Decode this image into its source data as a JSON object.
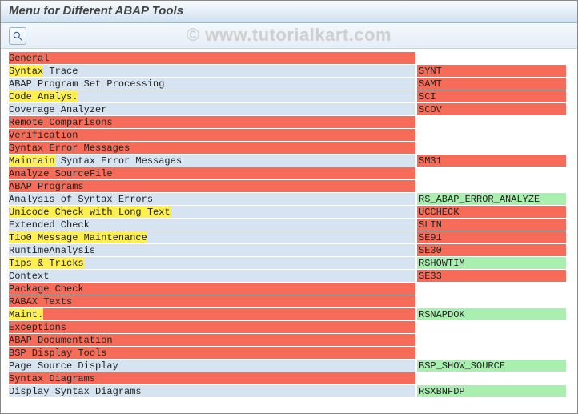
{
  "title": "Menu for Different ABAP Tools",
  "watermark": "© www.tutorialkart.com",
  "rows": [
    {
      "label": "General",
      "label_bg": "red",
      "hl_text": "",
      "hl_bg": "",
      "code": "",
      "code_bg": "none"
    },
    {
      "label": " Trace",
      "label_bg": "blue",
      "hl_text": "Syntax",
      "hl_bg": "yellow",
      "code": "SYNT",
      "code_bg": "red"
    },
    {
      "label": "ABAP Program Set Processing",
      "label_bg": "blue",
      "hl_text": "",
      "hl_bg": "",
      "code": "SAMT",
      "code_bg": "red"
    },
    {
      "label": "",
      "label_bg": "blue",
      "hl_text": "Code Analys.",
      "hl_bg": "yellow",
      "code": "SCI",
      "code_bg": "red"
    },
    {
      "label": "Coverage Analyzer",
      "label_bg": "blue",
      "hl_text": "",
      "hl_bg": "",
      "code": "SCOV",
      "code_bg": "red"
    },
    {
      "label": "Remote Comparisons",
      "label_bg": "red",
      "hl_text": "",
      "hl_bg": "",
      "code": "",
      "code_bg": "none"
    },
    {
      "label": "Verification",
      "label_bg": "red",
      "hl_text": "",
      "hl_bg": "",
      "code": "",
      "code_bg": "none"
    },
    {
      "label": "Syntax Error Messages",
      "label_bg": "red",
      "hl_text": "",
      "hl_bg": "",
      "code": "",
      "code_bg": "none"
    },
    {
      "label": " Syntax Error Messages",
      "label_bg": "blue",
      "hl_text": "Maintain",
      "hl_bg": "yellow",
      "code": "SM31",
      "code_bg": "red"
    },
    {
      "label": "Analyze SourceFile",
      "label_bg": "red",
      "hl_text": "",
      "hl_bg": "",
      "code": "",
      "code_bg": "none"
    },
    {
      "label": "ABAP Programs",
      "label_bg": "red",
      "hl_text": "",
      "hl_bg": "",
      "code": "",
      "code_bg": "none"
    },
    {
      "label": "Analysis of Syntax Errors",
      "label_bg": "blue",
      "hl_text": "",
      "hl_bg": "",
      "code": "RS_ABAP_ERROR_ANALYZE",
      "code_bg": "green"
    },
    {
      "label": "",
      "label_bg": "blue",
      "hl_text": "Unicode Check with Long Text",
      "hl_bg": "yellow",
      "code": "UCCHECK",
      "code_bg": "red"
    },
    {
      "label": "Extended Check",
      "label_bg": "blue",
      "hl_text": "",
      "hl_bg": "",
      "code": "SLIN",
      "code_bg": "red"
    },
    {
      "label": "",
      "label_bg": "blue",
      "hl_text": "T1o0 Message Maintenance",
      "hl_bg": "yellow",
      "code": "SE91",
      "code_bg": "red"
    },
    {
      "label": "RuntimeAnalysis",
      "label_bg": "blue",
      "hl_text": "",
      "hl_bg": "",
      "code": "SE30",
      "code_bg": "red"
    },
    {
      "label": "",
      "label_bg": "blue",
      "hl_text": "Tips & Tricks",
      "hl_bg": "yellow",
      "code": "RSHOWTIM",
      "code_bg": "green"
    },
    {
      "label": "Context",
      "label_bg": "blue",
      "hl_text": "",
      "hl_bg": "",
      "code": "SE33",
      "code_bg": "red"
    },
    {
      "label": "Package Check",
      "label_bg": "red",
      "hl_text": "",
      "hl_bg": "",
      "code": "",
      "code_bg": "none"
    },
    {
      "label": "RABAX Texts",
      "label_bg": "red",
      "hl_text": "",
      "hl_bg": "",
      "code": "",
      "code_bg": "none"
    },
    {
      "label": "",
      "label_bg": "red",
      "hl_text": "Maint.",
      "hl_bg": "yellow",
      "code": "RSNAPDOK",
      "code_bg": "green"
    },
    {
      "label": "Exceptions",
      "label_bg": "red",
      "hl_text": "",
      "hl_bg": "",
      "code": "",
      "code_bg": "none"
    },
    {
      "label": "ABAP Documentation",
      "label_bg": "red",
      "hl_text": "",
      "hl_bg": "",
      "code": "",
      "code_bg": "none"
    },
    {
      "label": "BSP Display Tools",
      "label_bg": "red",
      "hl_text": "",
      "hl_bg": "",
      "code": "",
      "code_bg": "none"
    },
    {
      "label": "Page Source Display",
      "label_bg": "blue",
      "hl_text": "",
      "hl_bg": "",
      "code": "BSP_SHOW_SOURCE",
      "code_bg": "green"
    },
    {
      "label": "Syntax Diagrams",
      "label_bg": "red",
      "hl_text": "",
      "hl_bg": "",
      "code": "",
      "code_bg": "none"
    },
    {
      "label": "Display Syntax Diagrams",
      "label_bg": "blue",
      "hl_text": "",
      "hl_bg": "",
      "code": "RSXBNFDP",
      "code_bg": "green"
    }
  ]
}
